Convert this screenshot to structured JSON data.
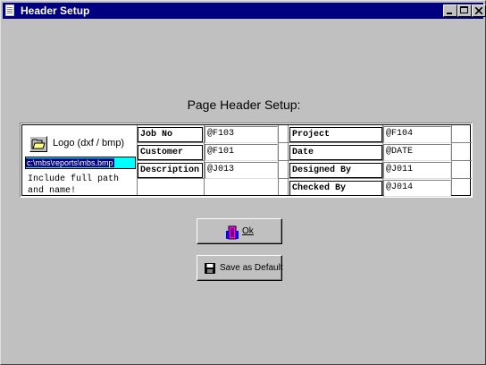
{
  "window": {
    "title": "Header Setup",
    "controls": {
      "minimize": "minimize-icon",
      "maximize": "maximize-icon",
      "close": "close-icon"
    }
  },
  "heading": "Page Header Setup:",
  "logo": {
    "button_icon": "folder-open-icon",
    "label": "Logo (dxf / bmp)",
    "path_value": "c:\\mbs\\reports\\mbs.bmp",
    "hint_line1": "Include full path",
    "hint_line2": "and name!"
  },
  "left_fields": [
    {
      "label": "Job No",
      "value": "@F103"
    },
    {
      "label": "Customer",
      "value": "@F101"
    },
    {
      "label": "Description",
      "value": "@J013"
    }
  ],
  "right_fields": [
    {
      "label": "Project",
      "value": "@F104"
    },
    {
      "label": "Date",
      "value": "@DATE"
    },
    {
      "label": "Designed By",
      "value": "@J011"
    },
    {
      "label": "Checked By",
      "value": "@J014"
    }
  ],
  "buttons": {
    "ok": {
      "label": "Ok",
      "icon": "door-exit-icon"
    },
    "save_default": {
      "label": "Save as Default",
      "icon": "floppy-disk-icon"
    }
  }
}
